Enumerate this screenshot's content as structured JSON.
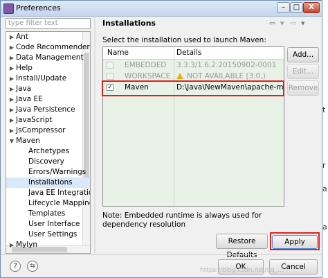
{
  "window": {
    "title": "Preferences",
    "close_label": "X"
  },
  "filter": {
    "placeholder": "type filter text"
  },
  "tree": [
    {
      "label": "Ant",
      "indent": 0,
      "expandable": true
    },
    {
      "label": "Code Recommenders",
      "indent": 0,
      "expandable": true
    },
    {
      "label": "Data Management",
      "indent": 0,
      "expandable": true
    },
    {
      "label": "Help",
      "indent": 0,
      "expandable": true
    },
    {
      "label": "Install/Update",
      "indent": 0,
      "expandable": true
    },
    {
      "label": "Java",
      "indent": 0,
      "expandable": true
    },
    {
      "label": "Java EE",
      "indent": 0,
      "expandable": true
    },
    {
      "label": "Java Persistence",
      "indent": 0,
      "expandable": true
    },
    {
      "label": "JavaScript",
      "indent": 0,
      "expandable": true
    },
    {
      "label": "JsCompressor",
      "indent": 0,
      "expandable": true
    },
    {
      "label": "Maven",
      "indent": 0,
      "expandable": true,
      "expanded": true
    },
    {
      "label": "Archetypes",
      "indent": 1
    },
    {
      "label": "Discovery",
      "indent": 1
    },
    {
      "label": "Errors/Warnings",
      "indent": 1
    },
    {
      "label": "Installations",
      "indent": 1,
      "selected": true
    },
    {
      "label": "Java EE Integration",
      "indent": 1
    },
    {
      "label": "Lifecycle Mapping",
      "indent": 1
    },
    {
      "label": "Templates",
      "indent": 1
    },
    {
      "label": "User Interface",
      "indent": 1
    },
    {
      "label": "User Settings",
      "indent": 1
    },
    {
      "label": "Mylyn",
      "indent": 0,
      "expandable": true
    }
  ],
  "page": {
    "title": "Installations",
    "prompt": "Select the installation used to launch Maven:",
    "nav": {
      "back": "⇦",
      "forward": "⇨",
      "menu": "▾"
    }
  },
  "table": {
    "columns": [
      "Name",
      "Details"
    ],
    "rows": [
      {
        "checked": false,
        "name": "EMBEDDED",
        "details": "3.3.3/1.6.2.20150902-0001",
        "disabled": true,
        "warning": false
      },
      {
        "checked": false,
        "name": "WORKSPACE",
        "details": "NOT AVAILABLE [3.0,)",
        "disabled": true,
        "warning": true
      },
      {
        "checked": true,
        "name": "Maven",
        "details": "D:\\Java\\NewMaven\\apache-maven-",
        "disabled": false,
        "warning": false
      }
    ]
  },
  "side_buttons": {
    "add": "Add...",
    "edit": "Edit...",
    "remove": "Remove"
  },
  "note": "Note: Embedded runtime is always used for dependency resolution",
  "buttons": {
    "restore": "Restore Defaults",
    "apply": "Apply",
    "ok": "OK",
    "cancel": "Cancel"
  },
  "footer": {
    "help_icon": "?",
    "import_icon": "⇆"
  },
  "watermark": "https://blog.csdn.net/qq_...",
  "edge_chars": [
    "t",
    "r",
    "a",
    "a"
  ],
  "colors": {
    "table_bg": "#e8f2e6",
    "highlight": "#e02020",
    "selection": "#d9e8fb"
  }
}
